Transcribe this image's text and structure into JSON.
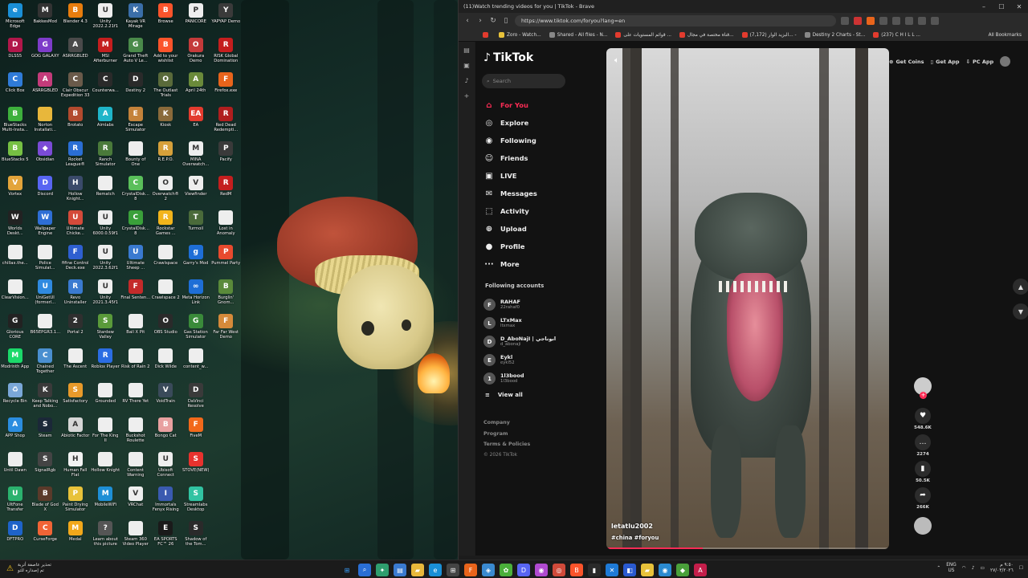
{
  "desktop": {
    "icons": [
      {
        "label": "Microsoft Edge",
        "icon": "edge-icon",
        "color": "#1a8fd6",
        "glyph": "e"
      },
      {
        "label": "DLSS5",
        "icon": "dlss-icon",
        "color": "#b1174a",
        "glyph": "D"
      },
      {
        "label": "Click Box",
        "icon": "clickbox-icon",
        "color": "#2f7bd8",
        "glyph": "C"
      },
      {
        "label": "BlueStacks Multi-Insta...",
        "icon": "bluestacks-icon",
        "color": "#3db03c",
        "glyph": "B"
      },
      {
        "label": "BlueStacks 5",
        "icon": "bluestacks-icon",
        "color": "#76c043",
        "glyph": "B"
      },
      {
        "label": "Vortex",
        "icon": "vortex-icon",
        "color": "#e3a43a",
        "glyph": "V"
      },
      {
        "label": "Worlds Deskt...",
        "icon": "worlds-icon",
        "color": "#222",
        "glyph": "W"
      },
      {
        "label": "chillax.the...",
        "icon": "file-icon",
        "color": "#eee",
        "glyph": ""
      },
      {
        "label": "ClearVision...",
        "icon": "file-icon",
        "color": "#eee",
        "glyph": ""
      },
      {
        "label": "Glorious CORE",
        "icon": "glorious-icon",
        "color": "#222",
        "glyph": "G"
      },
      {
        "label": "Modrinth App",
        "icon": "modrinth-icon",
        "color": "#1bd96a",
        "glyph": "M"
      },
      {
        "label": "Recycle Bin",
        "icon": "recycle-bin-icon",
        "color": "#7aa7d8",
        "glyph": "♻"
      },
      {
        "label": "APP Shop",
        "icon": "appshop-icon",
        "color": "#2b8de0",
        "glyph": "A"
      },
      {
        "label": "Until Dawn",
        "icon": "file-icon",
        "color": "#eee",
        "glyph": ""
      },
      {
        "label": "UltFone Transfer",
        "icon": "ultfone-icon",
        "color": "#2bb26e",
        "glyph": "U"
      },
      {
        "label": "DFTPRO",
        "icon": "dftpro-icon",
        "color": "#1e63c9",
        "glyph": "D"
      },
      {
        "label": "BakkesMod",
        "icon": "bakkesmod-icon",
        "color": "#333",
        "glyph": "M"
      },
      {
        "label": "GOG GALAXY",
        "icon": "gog-icon",
        "color": "#7d3cc9",
        "glyph": "G"
      },
      {
        "label": "ASRRGBLED",
        "icon": "asr-icon",
        "color": "#c43b7a",
        "glyph": "A"
      },
      {
        "label": "Norton Installati...",
        "icon": "folder-icon",
        "color": "#e8b73b",
        "glyph": ""
      },
      {
        "label": "Obsidian",
        "icon": "obsidian-icon",
        "color": "#7b4bd6",
        "glyph": "◆"
      },
      {
        "label": "Discord",
        "icon": "discord-icon",
        "color": "#5865f2",
        "glyph": "D"
      },
      {
        "label": "Wallpaper Engine",
        "icon": "wallpaper-engine-icon",
        "color": "#2e6ed5",
        "glyph": "W"
      },
      {
        "label": "Police Simulat...",
        "icon": "file-icon",
        "color": "#eee",
        "glyph": ""
      },
      {
        "label": "UniGetUI (formerl...",
        "icon": "unigetui-icon",
        "color": "#2f8ae0",
        "glyph": "U"
      },
      {
        "label": "B65EPGR3.1...",
        "icon": "file-icon",
        "color": "#eee",
        "glyph": ""
      },
      {
        "label": "Chained Together",
        "icon": "chained-icon",
        "color": "#4a8fd0",
        "glyph": "C"
      },
      {
        "label": "Keep Talking and Nobo...",
        "icon": "keeptalking-icon",
        "color": "#3a3a3a",
        "glyph": "K"
      },
      {
        "label": "Steam",
        "icon": "steam-icon",
        "color": "#1b2838",
        "glyph": "S"
      },
      {
        "label": "SignalRgb",
        "icon": "signalrgb-icon",
        "color": "#444",
        "glyph": "S"
      },
      {
        "label": "Blade of God X",
        "icon": "bladeofgod-icon",
        "color": "#5a3a2a",
        "glyph": "B"
      },
      {
        "label": "CurseForge",
        "icon": "curseforge-icon",
        "color": "#f16436",
        "glyph": "C"
      },
      {
        "label": "Blender 4.3",
        "icon": "blender-icon",
        "color": "#e87d0d",
        "glyph": "B"
      },
      {
        "label": "ASRRGBLED",
        "icon": "asr-icon",
        "color": "#4a4a4a",
        "glyph": "A"
      },
      {
        "label": "Clair Obscur Expedition 33",
        "icon": "clairobscur-icon",
        "color": "#6a5a4a",
        "glyph": "C"
      },
      {
        "label": "Brotato",
        "icon": "brotato-icon",
        "color": "#b24a2e",
        "glyph": "B"
      },
      {
        "label": "Rocket League®",
        "icon": "rocketleague-icon",
        "color": "#2a6ed4",
        "glyph": "R"
      },
      {
        "label": "Hollow Knight...",
        "icon": "hollowknight-icon",
        "color": "#3a4a6a",
        "glyph": "H"
      },
      {
        "label": "Ultimate Chicke...",
        "icon": "chicken-icon",
        "color": "#d44a3a",
        "glyph": "U"
      },
      {
        "label": "fifine Control Deck.exe",
        "icon": "fifine-icon",
        "color": "#2e5fd0",
        "glyph": "F"
      },
      {
        "label": "Revo Uninstaller",
        "icon": "revo-icon",
        "color": "#3a7ad0",
        "glyph": "R"
      },
      {
        "label": "Portal 2",
        "icon": "portal-icon",
        "color": "#2f2f2f",
        "glyph": "2"
      },
      {
        "label": "The Ascent",
        "icon": "file-icon",
        "color": "#eee",
        "glyph": ""
      },
      {
        "label": "Satisfactory",
        "icon": "satisfactory-icon",
        "color": "#e89a2a",
        "glyph": "S"
      },
      {
        "label": "Abiotic Factor",
        "icon": "abiotic-icon",
        "color": "#d6d6d6",
        "glyph": "A"
      },
      {
        "label": "Human Fall Flat",
        "icon": "humanfall-icon",
        "color": "#f2f2f2",
        "glyph": "H"
      },
      {
        "label": "Paint Drying Simulator",
        "icon": "paintdrying-icon",
        "color": "#e8c23a",
        "glyph": "P"
      },
      {
        "label": "Medal",
        "icon": "medal-icon",
        "color": "#f2a81b",
        "glyph": "M"
      },
      {
        "label": "Unity 2022.2.21f1",
        "icon": "unity-icon",
        "color": "#eee",
        "glyph": "U"
      },
      {
        "label": "MSI Afterburner",
        "icon": "msi-icon",
        "color": "#c41e1e",
        "glyph": "M"
      },
      {
        "label": "Counterwa...",
        "icon": "counterwa-icon",
        "color": "#2a2a2a",
        "glyph": "C"
      },
      {
        "label": "Aimlabs",
        "icon": "aimlabs-icon",
        "color": "#1fb5c9",
        "glyph": "A"
      },
      {
        "label": "Ranch Simulator",
        "icon": "ranch-icon",
        "color": "#4a7a3a",
        "glyph": "R"
      },
      {
        "label": "Rematch",
        "icon": "file-icon",
        "color": "#eee",
        "glyph": ""
      },
      {
        "label": "Unity 6000.0.59f1",
        "icon": "unity-icon",
        "color": "#eee",
        "glyph": "U"
      },
      {
        "label": "Unity 2022.3.62f1",
        "icon": "unity-icon",
        "color": "#eee",
        "glyph": "U"
      },
      {
        "label": "Unity 2021.3.45f1",
        "icon": "unity-icon",
        "color": "#eee",
        "glyph": "U"
      },
      {
        "label": "Stardew Valley",
        "icon": "stardew-icon",
        "color": "#5a9a3a",
        "glyph": "S"
      },
      {
        "label": "Roblox Player",
        "icon": "roblox-icon",
        "color": "#2b6de3",
        "glyph": "R"
      },
      {
        "label": "Grounded",
        "icon": "file-icon",
        "color": "#eee",
        "glyph": ""
      },
      {
        "label": "For The King II",
        "icon": "file-icon",
        "color": "#eee",
        "glyph": ""
      },
      {
        "label": "Hollow Knight",
        "icon": "file-icon",
        "color": "#eee",
        "glyph": ""
      },
      {
        "label": "MobileWiFi",
        "icon": "mobilewifi-icon",
        "color": "#1e8fd6",
        "glyph": "M"
      },
      {
        "label": "Learn about this picture",
        "icon": "learn-picture-icon",
        "color": "#555",
        "glyph": "?"
      },
      {
        "label": "Kayak VR Mirage",
        "icon": "kayak-icon",
        "color": "#3a6ea8",
        "glyph": "K"
      },
      {
        "label": "Grand Theft Auto V Le...",
        "icon": "gta-icon",
        "color": "#4a8a4a",
        "glyph": "G"
      },
      {
        "label": "Destiny 2",
        "icon": "destiny-icon",
        "color": "#2a2a2a",
        "glyph": "D"
      },
      {
        "label": "Escape Simulator",
        "icon": "escape-icon",
        "color": "#c4823a",
        "glyph": "E"
      },
      {
        "label": "Bounty of One",
        "icon": "file-icon",
        "color": "#eee",
        "glyph": ""
      },
      {
        "label": "CrystalDisk... 8",
        "icon": "crystaldisk-icon",
        "color": "#5abf5a",
        "glyph": "C"
      },
      {
        "label": "CrystalDisk... 8",
        "icon": "crystaldisk-icon",
        "color": "#3aa03a",
        "glyph": "C"
      },
      {
        "label": "Ultimate Sheep ...",
        "icon": "sheep-icon",
        "color": "#3a7ad0",
        "glyph": "U"
      },
      {
        "label": "Final Senten...",
        "icon": "finalsentence-icon",
        "color": "#c42a2a",
        "glyph": "F"
      },
      {
        "label": "Ball X Pit",
        "icon": "file-icon",
        "color": "#eee",
        "glyph": ""
      },
      {
        "label": "Risk of Rain 2",
        "icon": "file-icon",
        "color": "#eee",
        "glyph": ""
      },
      {
        "label": "RV There Yet",
        "icon": "file-icon",
        "color": "#eee",
        "glyph": ""
      },
      {
        "label": "Buckshot Roulette",
        "icon": "file-icon",
        "color": "#eee",
        "glyph": ""
      },
      {
        "label": "Content Warning",
        "icon": "file-icon",
        "color": "#eee",
        "glyph": ""
      },
      {
        "label": "VRChat",
        "icon": "vrchat-icon",
        "color": "#eee",
        "glyph": "V"
      },
      {
        "label": "Steam 360 Video Player",
        "icon": "file-icon",
        "color": "#eee",
        "glyph": ""
      },
      {
        "label": "Browse",
        "icon": "brave-icon",
        "color": "#fb542b",
        "glyph": "B"
      },
      {
        "label": "Add to your wishlist",
        "icon": "brave-icon",
        "color": "#fb542b",
        "glyph": "B"
      },
      {
        "label": "The Outlast Trials",
        "icon": "outlast-icon",
        "color": "#5a6a3a",
        "glyph": "O"
      },
      {
        "label": "Kiosk",
        "icon": "kiosk-icon",
        "color": "#8a6a3a",
        "glyph": "K"
      },
      {
        "label": "R.E.P.O.",
        "icon": "repo-icon",
        "color": "#d6a03a",
        "glyph": "R"
      },
      {
        "label": "Overwatch® 2",
        "icon": "overwatch-icon",
        "color": "#eee",
        "glyph": "O"
      },
      {
        "label": "Rockstar Games ...",
        "icon": "rockstar-icon",
        "color": "#f2b41b",
        "glyph": "R"
      },
      {
        "label": "Crawlspace",
        "icon": "file-icon",
        "color": "#eee",
        "glyph": ""
      },
      {
        "label": "Crawlspace 2",
        "icon": "file-icon",
        "color": "#eee",
        "glyph": ""
      },
      {
        "label": "OBS Studio",
        "icon": "obs-icon",
        "color": "#2a2a2a",
        "glyph": "O"
      },
      {
        "label": "Dick Wilde",
        "icon": "file-icon",
        "color": "#eee",
        "glyph": ""
      },
      {
        "label": "VoidTrain",
        "icon": "voidtrain-icon",
        "color": "#3a4a5a",
        "glyph": "V"
      },
      {
        "label": "Bongo Cat",
        "icon": "bongocat-icon",
        "color": "#e8a0a0",
        "glyph": "B"
      },
      {
        "label": "Ubisoft Connect",
        "icon": "ubisoft-icon",
        "color": "#eee",
        "glyph": "U"
      },
      {
        "label": "Immortals Fenyx Rising",
        "icon": "immortals-icon",
        "color": "#3a5ab0",
        "glyph": "I"
      },
      {
        "label": "EA SPORTS FC™ 26",
        "icon": "easports-icon",
        "color": "#1a1a1a",
        "glyph": "E"
      },
      {
        "label": "PANICORE",
        "icon": "panicore-icon",
        "color": "#eee",
        "glyph": "P"
      },
      {
        "label": "Orakura Demo",
        "icon": "orakura-icon",
        "color": "#c43a3a",
        "glyph": "O"
      },
      {
        "label": "April 24th",
        "icon": "april-icon",
        "color": "#6a8a3a",
        "glyph": "A"
      },
      {
        "label": "EA",
        "icon": "ea-icon",
        "color": "#e23b2e",
        "glyph": "EA"
      },
      {
        "label": "MINA Overwatch...",
        "icon": "mina-icon",
        "color": "#eee",
        "glyph": "M"
      },
      {
        "label": "Viewfinder",
        "icon": "viewfinder-icon",
        "color": "#eee",
        "glyph": "V"
      },
      {
        "label": "Turmoil",
        "icon": "turmoil-icon",
        "color": "#4a6a3a",
        "glyph": "T"
      },
      {
        "label": "Garry's Mod",
        "icon": "garrysmod-icon",
        "color": "#1e6ed6",
        "glyph": "g"
      },
      {
        "label": "Meta Horizon Link",
        "icon": "meta-icon",
        "color": "#1e6ed6",
        "glyph": "∞"
      },
      {
        "label": "Gas Station Simulator",
        "icon": "gasstation-icon",
        "color": "#3a8a3a",
        "glyph": "G"
      },
      {
        "label": "content_w...",
        "icon": "file-icon",
        "color": "#eee",
        "glyph": ""
      },
      {
        "label": "DaVinci Resolve",
        "icon": "davinci-icon",
        "color": "#3a3a3a",
        "glyph": "D"
      },
      {
        "label": "FiveM",
        "icon": "fivem-icon",
        "color": "#f2691b",
        "glyph": "F"
      },
      {
        "label": "STOVE(NEW)",
        "icon": "stove-icon",
        "color": "#e8322e",
        "glyph": "S"
      },
      {
        "label": "Streamlabs Desktop",
        "icon": "streamlabs-icon",
        "color": "#31c3a2",
        "glyph": "S"
      },
      {
        "label": "Shadow of the Tom...",
        "icon": "shadowtomb-icon",
        "color": "#2a2a2a",
        "glyph": "S"
      },
      {
        "label": "YAPYAP Demo",
        "icon": "yapyap-icon",
        "color": "#3a3a3a",
        "glyph": "Y"
      },
      {
        "label": "RISK Global Domination",
        "icon": "risk-icon",
        "color": "#c41e1e",
        "glyph": "R"
      },
      {
        "label": "Firefox.exe",
        "icon": "firefox-icon",
        "color": "#e8641b",
        "glyph": "F"
      },
      {
        "label": "Red Dead Redempti...",
        "icon": "reddead-icon",
        "color": "#b01e1e",
        "glyph": "R"
      },
      {
        "label": "Pacify",
        "icon": "pacify-icon",
        "color": "#3a3a3a",
        "glyph": "P"
      },
      {
        "label": "RedM",
        "icon": "redm-icon",
        "color": "#c41e1e",
        "glyph": "R"
      },
      {
        "label": "Lost in Anomaly",
        "icon": "file-icon",
        "color": "#eee",
        "glyph": ""
      },
      {
        "label": "Pummel Party",
        "icon": "pummel-icon",
        "color": "#e84a2e",
        "glyph": "P"
      },
      {
        "label": "Burglin' Gnom...",
        "icon": "burglin-icon",
        "color": "#5a8a3a",
        "glyph": "B"
      },
      {
        "label": "Far Far West Demo",
        "icon": "farwest-icon",
        "color": "#d68a3a",
        "glyph": "F"
      }
    ]
  },
  "browser": {
    "window_title": "(11)Watch trending videos for you | TikTok - Brave",
    "url": "https://www.tiktok.com/foryou?lang=en",
    "bookmarks": [
      {
        "label": "",
        "color": "#e23b2e"
      },
      {
        "label": "Zoro - Watch...",
        "color": "#e8c23a"
      },
      {
        "label": "Shared - All files - N...",
        "color": "#888"
      },
      {
        "label": "قوائم المستويات على ...",
        "color": "#e23b2e"
      },
      {
        "label": "قناة مختصة في مجال...",
        "color": "#e23b2e"
      },
      {
        "label": "(7,172) البزيد الوار... -",
        "color": "#e23b2e"
      },
      {
        "label": "Destiny 2 Charts - St...",
        "color": "#888"
      },
      {
        "label": "(237) C H I L L ...",
        "color": "#e23b2e"
      }
    ],
    "all_bookmarks": "All Bookmarks"
  },
  "tiktok": {
    "logo": "TikTok",
    "search_placeholder": "Search",
    "nav": [
      {
        "label": "For You",
        "icon": "home-icon",
        "glyph": "⌂",
        "active": true
      },
      {
        "label": "Explore",
        "icon": "compass-icon",
        "glyph": "◎",
        "active": false
      },
      {
        "label": "Following",
        "icon": "following-icon",
        "glyph": "◉",
        "active": false
      },
      {
        "label": "Friends",
        "icon": "friends-icon",
        "glyph": "☺",
        "active": false
      },
      {
        "label": "LIVE",
        "icon": "live-icon",
        "glyph": "▣",
        "active": false
      },
      {
        "label": "Messages",
        "icon": "messages-icon",
        "glyph": "✉",
        "active": false
      },
      {
        "label": "Activity",
        "icon": "activity-icon",
        "glyph": "⬚",
        "active": false
      },
      {
        "label": "Upload",
        "icon": "upload-icon",
        "glyph": "⊕",
        "active": false
      },
      {
        "label": "Profile",
        "icon": "profile-icon",
        "glyph": "●",
        "active": false
      },
      {
        "label": "More",
        "icon": "more-icon",
        "glyph": "···",
        "active": false
      }
    ],
    "following_title": "Following accounts",
    "accounts": [
      {
        "name": "RAHAF",
        "handle": "22rahaf0",
        "initial": "F"
      },
      {
        "name": "LTxMax",
        "handle": "ltxmax",
        "initial": "L"
      },
      {
        "name": "D_AboNajI | ابوناجي",
        "handle": "d_abonaji",
        "initial": "D"
      },
      {
        "name": "Eykl",
        "handle": "eykl52",
        "initial": "E"
      },
      {
        "name": "1l3bood",
        "handle": "1l3bood",
        "initial": "1"
      }
    ],
    "view_all": "View all",
    "footer": {
      "company": "Company",
      "program": "Program",
      "terms": "Terms & Policies",
      "copyright": "© 2026 TikTok"
    },
    "top_actions": {
      "get_coins": "Get Coins",
      "get_app": "Get App",
      "pc_app": "PC App"
    },
    "video": {
      "username": "letatlu2002",
      "tags": "#china #foryou",
      "progress": 0.34
    },
    "counts": {
      "likes": "548.6K",
      "comments": "2274",
      "saves": "50.5K",
      "shares": "266K"
    }
  },
  "taskbar": {
    "weather_line1": "تحذير عاصفة أتربة",
    "weather_line2": "تم إصداره للتو",
    "language": "ENG",
    "region": "US",
    "time": "٩:٥٠ م",
    "date": "٢٧/٠٣/٢٠٢٦"
  }
}
